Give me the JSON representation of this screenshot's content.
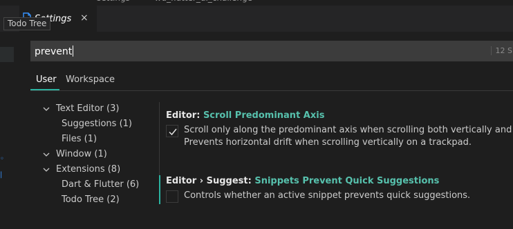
{
  "titlebar": {
    "segment_left": "settings",
    "segment_right": "wd_flutter_ui_challenge"
  },
  "tab": {
    "label": "Settings",
    "close": "×",
    "icon": "file-icon"
  },
  "tooltip": {
    "text": "Todo Tree"
  },
  "search": {
    "value": "prevent",
    "result_count": "12 S"
  },
  "scope_tabs": [
    {
      "label": "User",
      "active": true
    },
    {
      "label": "Workspace",
      "active": false
    }
  ],
  "tree": [
    {
      "label": "Text Editor (3)",
      "expanded": true
    },
    {
      "label": "Suggestions (1)"
    },
    {
      "label": "Files (1)"
    },
    {
      "label": "Window (1)",
      "expanded": true
    },
    {
      "label": "Extensions (8)",
      "expanded": true
    },
    {
      "label": "Dart & Flutter (6)"
    },
    {
      "label": "Todo Tree (2)"
    }
  ],
  "settings": [
    {
      "category": "Editor: ",
      "name": "Scroll Predominant Axis",
      "checked": true,
      "desc_line1": "Scroll only along the predominant axis when scrolling both vertically and horizontall",
      "desc_line2": "Prevents horizontal drift when scrolling vertically on a trackpad."
    },
    {
      "category": "Editor › Suggest: ",
      "name": "Snippets Prevent Quick Suggestions",
      "checked": false,
      "desc_line1": "Controls whether an active snippet prevents quick suggestions."
    }
  ],
  "colors": {
    "accent": "#2bb3a0",
    "setting_name": "#57c1ad",
    "background": "#1e1e1e"
  }
}
